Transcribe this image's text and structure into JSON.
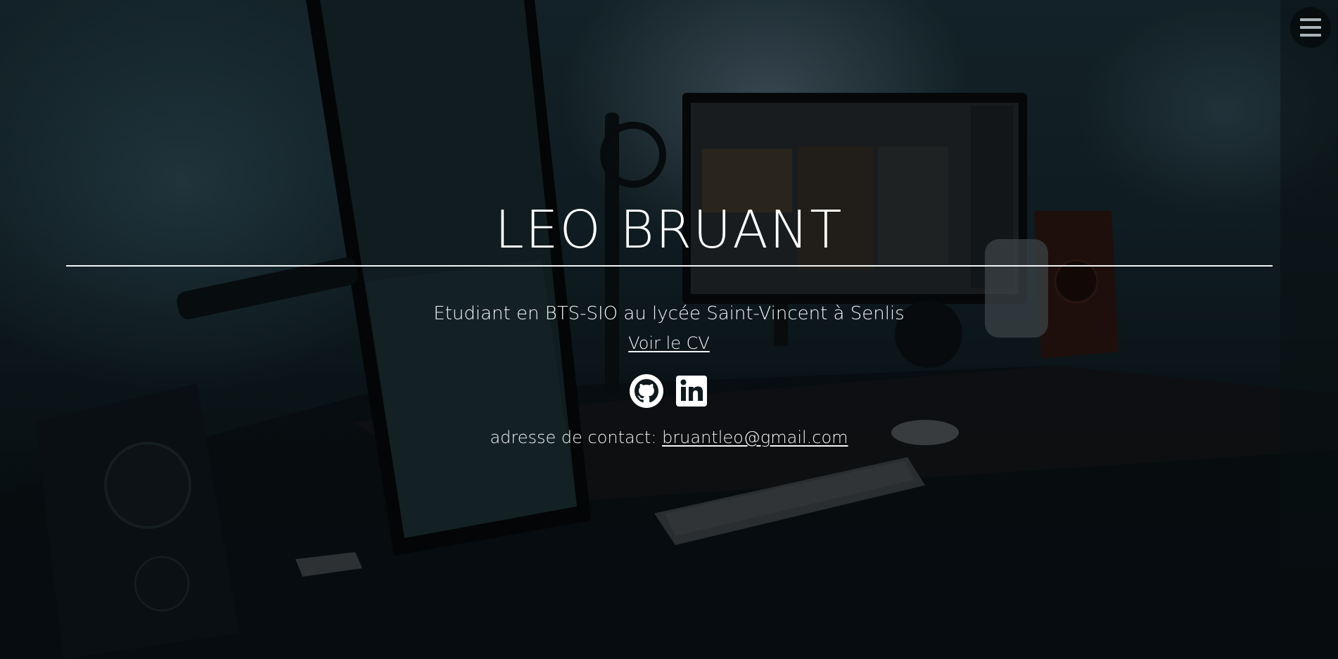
{
  "hero": {
    "name": "LEO BRUANT",
    "subtitle": "Etudiant en BTS-SIO au lycée Saint-Vincent à Senlis",
    "cv_link_label": "Voir le CV",
    "contact_prefix": "adresse de contact:",
    "contact_email": "bruantleo@gmail.com"
  },
  "menu": {
    "icon": "hamburger-menu-icon"
  },
  "social": {
    "items": [
      {
        "icon": "github-icon"
      },
      {
        "icon": "linkedin-icon"
      }
    ]
  },
  "colors": {
    "text": "#ffffff",
    "background_tint": "#14252c",
    "menu_bars": "#a9b4ba"
  }
}
